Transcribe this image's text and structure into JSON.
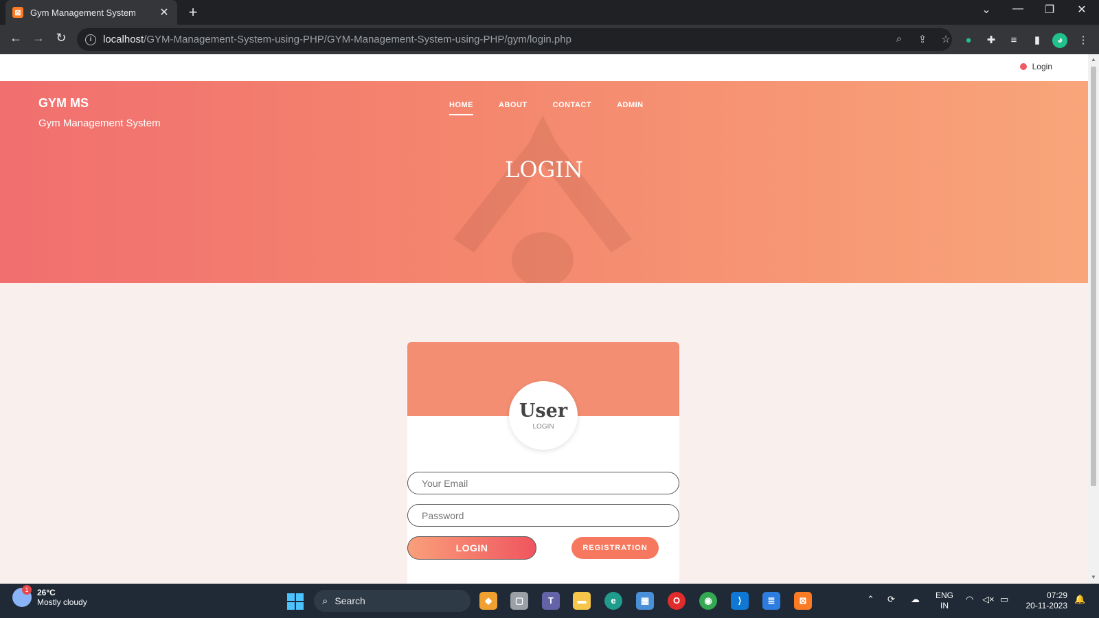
{
  "browser": {
    "tab_title": "Gym Management System",
    "tab_favicon": "xampp-icon",
    "url_host": "localhost",
    "url_path": "/GYM-Management-System-using-PHP/GYM-Management-System-using-PHP/gym/login.php"
  },
  "page": {
    "top_login": "Login",
    "brand_name": "GYM MS",
    "brand_sub": "Gym Management System",
    "menu": [
      "HOME",
      "ABOUT",
      "CONTACT",
      "ADMIN"
    ],
    "hero_title": "LOGIN",
    "card": {
      "avatar_title": "User",
      "avatar_sub": "LOGIN",
      "email_placeholder": "Your Email",
      "password_placeholder": "Password",
      "login_button": "LOGIN",
      "registration_button": "REGISTRATION"
    }
  },
  "taskbar": {
    "weather_temp": "26°C",
    "weather_desc": "Mostly cloudy",
    "weather_badge": "1",
    "search_label": "Search",
    "lang_line1": "ENG",
    "lang_line2": "IN",
    "time": "07:29",
    "date": "20-11-2023"
  },
  "colors": {
    "hero_start": "#f16f6f",
    "hero_end": "#f9a57a",
    "card_header": "#f48e73",
    "accent": "#f6795f"
  }
}
